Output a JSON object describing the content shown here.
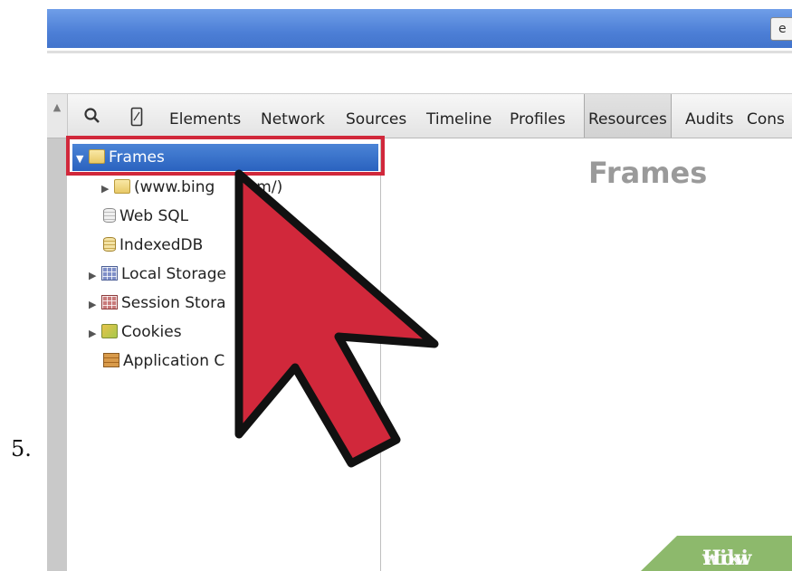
{
  "step": {
    "number": "5."
  },
  "browser": {
    "top_button_text": "e"
  },
  "devtools": {
    "tabs": [
      "Elements",
      "Network",
      "Sources",
      "Timeline",
      "Profiles",
      "Resources",
      "Audits",
      "Cons"
    ],
    "active_tab": "Resources",
    "sidebar": {
      "items": [
        {
          "label": "Frames",
          "icon": "folder-icon",
          "expanded": true,
          "selected": true
        },
        {
          "label": "(www.bing",
          "label_tail": "m/)",
          "icon": "folder-icon"
        },
        {
          "label": "Web SQL",
          "icon": "database-icon"
        },
        {
          "label": "IndexedDB",
          "icon": "database-icon"
        },
        {
          "label": "Local Storage",
          "icon": "grid-icon"
        },
        {
          "label": "Session Stora",
          "icon": "grid-icon"
        },
        {
          "label": "Cookies",
          "icon": "cookie-icon"
        },
        {
          "label": "Application C",
          "icon": "app-cache-icon"
        }
      ]
    },
    "content": {
      "title": "Frames"
    }
  },
  "watermark": {
    "part1": "wiki",
    "part2": "How"
  },
  "colors": {
    "highlight": "#d1283b",
    "cursor": "#d1283b",
    "selection": "#2f68c4",
    "browser_bar": "#4d7fd6"
  }
}
